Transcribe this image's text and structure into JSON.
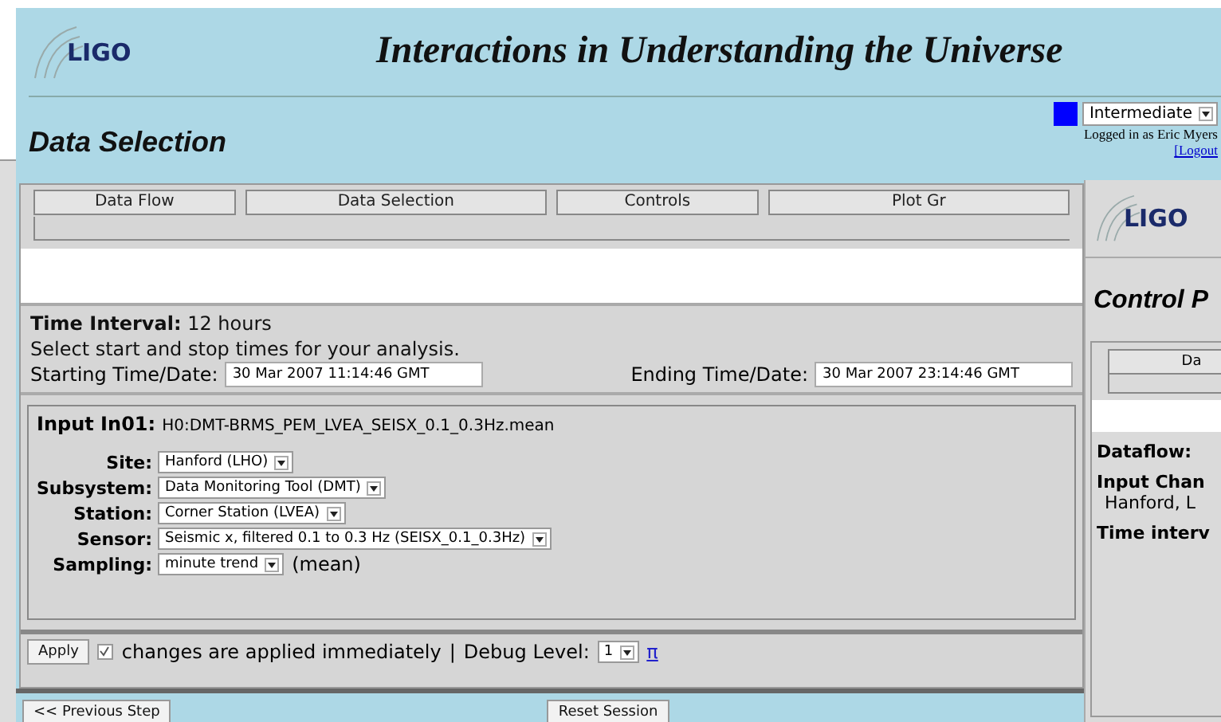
{
  "main_window": {
    "header": {
      "logo": "LIGO",
      "title": "Interactions in Understanding the Universe"
    },
    "page_title": "Data Selection",
    "level_select": {
      "value": "Intermediate"
    },
    "login": {
      "text": "Logged in as Eric Myers",
      "link": "[Logout"
    },
    "tabs": [
      "Data Flow",
      "Data Selection",
      "Controls",
      "Plot Gr"
    ],
    "time_interval": {
      "label": "Time Interval:",
      "value": "12 hours"
    },
    "instruction": "Select start and stop times for your analysis.",
    "start": {
      "label": "Starting Time/Date:",
      "value": "30 Mar 2007 11:14:46 GMT"
    },
    "end": {
      "label": "Ending Time/Date:",
      "value": "30 Mar 2007 23:14:46 GMT"
    },
    "input": {
      "label": "Input In01:",
      "channel": "H0:DMT-BRMS_PEM_LVEA_SEISX_0.1_0.3Hz.mean",
      "fields": [
        {
          "label": "Site:",
          "value": "Hanford (LHO)"
        },
        {
          "label": "Subsystem:",
          "value": "Data Monitoring Tool (DMT)"
        },
        {
          "label": "Station:",
          "value": "Corner Station (LVEA)"
        },
        {
          "label": "Sensor:",
          "value": "Seismic x, filtered 0.1 to 0.3 Hz (SEISX_0.1_0.3Hz)"
        },
        {
          "label": "Sampling:",
          "value": "minute trend",
          "suffix": "(mean)"
        }
      ]
    },
    "apply_bar": {
      "button": "Apply",
      "checkbox": {
        "checked": true,
        "label": "changes are applied immediately"
      },
      "separator": "|",
      "debug_label": "Debug Level:",
      "debug_value": "1",
      "link": "π"
    },
    "buttons": [
      "<< Previous Step",
      "Reset Session"
    ]
  },
  "back_window": {
    "logo": "LIGO",
    "page_title": "Control P",
    "tab": "Da",
    "lines": [
      {
        "kind": "heading",
        "text": "Dataflow:"
      },
      {
        "kind": "heading",
        "text": "Input Chan"
      },
      {
        "kind": "plain",
        "text": "Hanford, L"
      },
      {
        "kind": "heading",
        "text": "Time interv"
      }
    ]
  }
}
